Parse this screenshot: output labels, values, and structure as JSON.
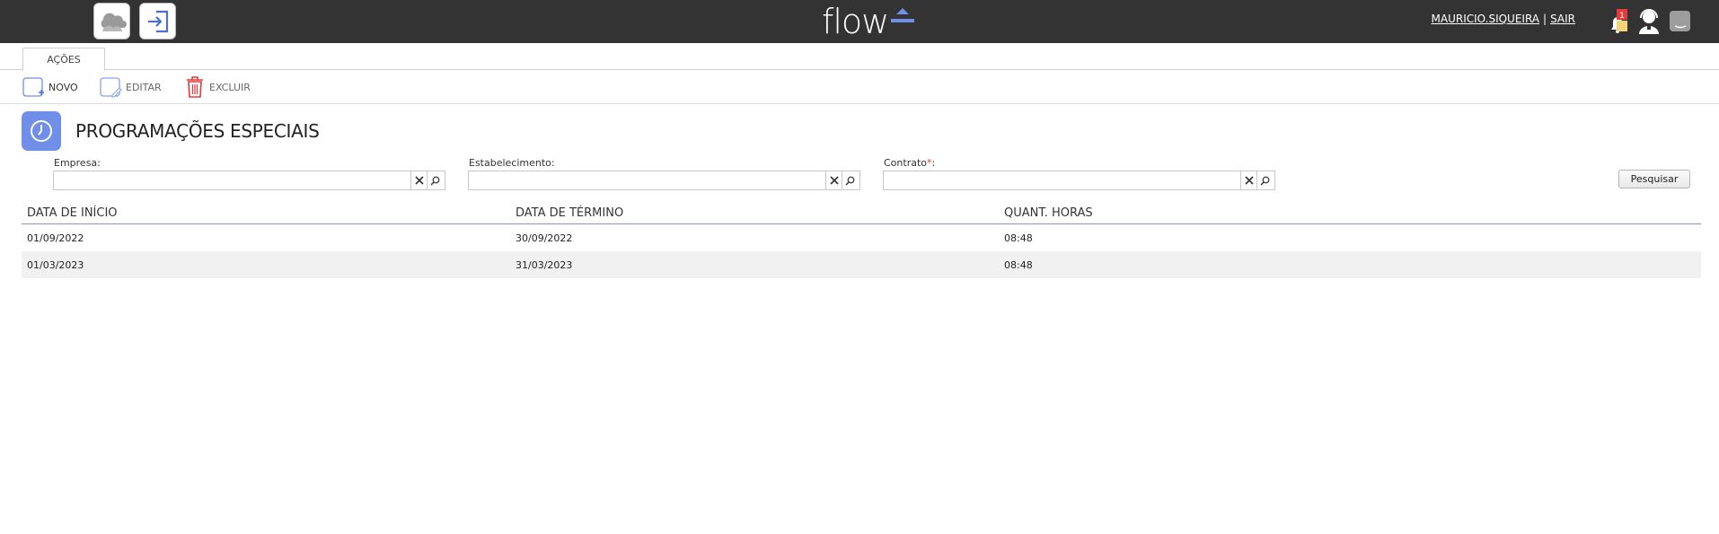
{
  "topbar": {
    "logo_text": "flow",
    "user_name": "MAURICIO.SIQUEIRA",
    "separator": "|",
    "logout": "SAIR",
    "notification_count": "1",
    "icons": [
      "cloud-app-icon",
      "exit-app-icon",
      "bell-icon",
      "support-agent-icon",
      "chat-icon"
    ],
    "bg_color": "#333333"
  },
  "tabs": [
    {
      "label": "AÇÕES"
    }
  ],
  "toolbar": {
    "novo": "NOVO",
    "editar": "EDITAR",
    "excluir": "EXCLUIR"
  },
  "page": {
    "title": "PROGRAMAÇÕES ESPECIAIS",
    "icon": "clock-icon",
    "accent_color": "#6f8fe8"
  },
  "filters": {
    "empresa_label": "Empresa:",
    "empresa_value": "",
    "estabelecimento_label": "Estabelecimento:",
    "estabelecimento_value": "",
    "contrato_label": "Contrato",
    "contrato_required": "*",
    "contrato_suffix": ":",
    "contrato_value": "",
    "search_button": "Pesquisar"
  },
  "table": {
    "columns": [
      "DATA DE INÍCIO",
      "DATA DE TÉRMINO",
      "QUANT. HORAS"
    ],
    "rows": [
      [
        "01/09/2022",
        "30/09/2022",
        "08:48"
      ],
      [
        "01/03/2023",
        "31/03/2023",
        "08:48"
      ]
    ]
  }
}
